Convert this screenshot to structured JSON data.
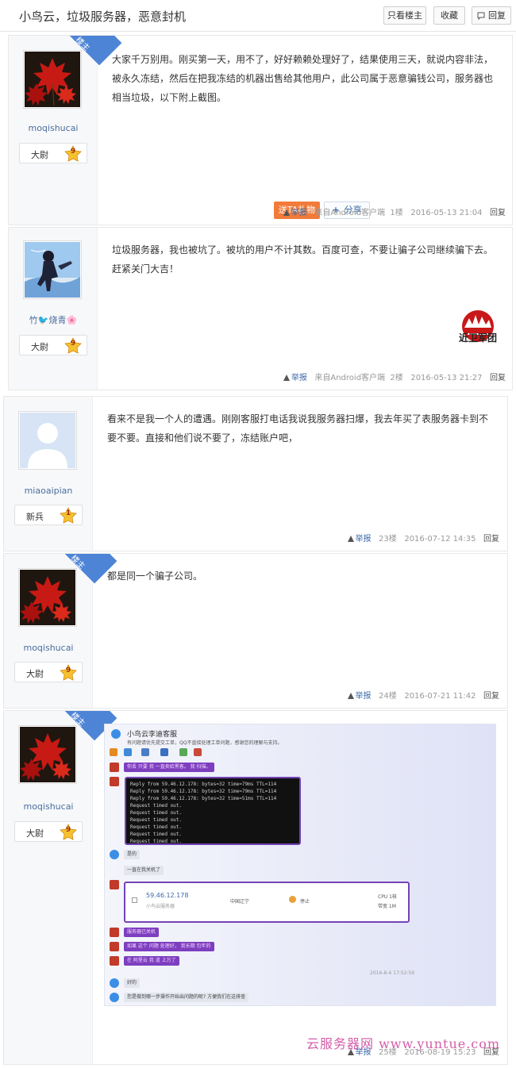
{
  "header": {
    "title": "小鸟云，垃圾服务器，恶意封机",
    "buttons": [
      "只看楼主",
      "收藏",
      "回复"
    ]
  },
  "colors": {
    "link": "#3a6aa8",
    "username": "#4a6e9e",
    "gift_button": "#f27b3a",
    "owner_badge": "#4d84d6",
    "chat_purple": "#7d3fbf",
    "watermark": "#d45ca9"
  },
  "icons": {
    "reply": "chat-bubble-icon",
    "report": "warning-triangle-icon",
    "share": "plus-icon",
    "rank": "star-badge-icon"
  },
  "common": {
    "owner_badge": "楼主",
    "report": "举报",
    "reply": "回复",
    "from_client": "来自Android客户端"
  },
  "posts": [
    {
      "owner": true,
      "username": "moqishucai",
      "rank": "大尉",
      "level": "9",
      "text": "大家千万别用。刚买第一天，用不了，好好赖赖处理好了，结果使用三天，就说内容非法，被永久冻结，然后在把我冻结的机器出售给其他用户，此公司属于恶意骗钱公司，服务器也相当垃圾，以下附上截图。",
      "gift": "送TA礼物",
      "share": "分享",
      "floor": "1楼",
      "time": "2016-05-13 21:04"
    },
    {
      "owner": false,
      "username": "竹🐦烧青🌸",
      "rank": "大尉",
      "level": "9",
      "text": "垃圾服务器，我也被坑了。被坑的用户不计其数。百度可查，不要让骗子公司继续骗下去。赶紧关门大吉！",
      "stamp": "近卫军团",
      "floor": "2楼",
      "time": "2016-05-13 21:27"
    },
    {
      "owner": false,
      "username": "miaoaipian",
      "rank": "新兵",
      "level": "1",
      "text": "看来不是我一个人的遭遇。刚刚客服打电话我说我服务器扫爆，我去年买了表服务器卡到不要不要。直接和他们说不要了，冻结账户吧，",
      "floor": "23楼",
      "time": "2016-07-12 14:35"
    },
    {
      "owner": true,
      "username": "moqishucai",
      "rank": "大尉",
      "level": "9",
      "text": "都是同一个骗子公司。",
      "floor": "24楼",
      "time": "2016-07-21 11:42"
    },
    {
      "owner": true,
      "username": "moqishucai",
      "rank": "大尉",
      "level": "9",
      "floor": "25楼",
      "time": "2016-08-19 15:23"
    }
  ],
  "screenshot": {
    "chat_title": "小鸟云李迪客服",
    "notice": "有问题请优先提交工单，QQ不直接处理工单问题，感谢您的理解与支持。",
    "msg1": "你丢 只要 我 一直卖给黑客。 我 扫描。",
    "terminal": [
      "Reply from 59.46.12.178: bytes=32 time=79ms TTL=114",
      "Reply from 59.46.12.178: bytes=32 time=79ms TTL=114",
      "Reply from 59.46.12.178: bytes=32 time=51ms TTL=114",
      "Request timed out.",
      "Request timed out.",
      "Request timed out.",
      "Request timed out.",
      "Request timed out.",
      "Request timed out."
    ],
    "reply1": "是的",
    "reply2": "一直在我关机了",
    "server_ip": "59.46.12.178",
    "server_name": "小鸟云服务器",
    "server_region": "中国辽宁",
    "server_status": "停止",
    "server_spec1": "CPU 1核",
    "server_spec2": "带宽 1M",
    "msg2": "服务器已关机",
    "msg3": "如果 这个 问题 处理好， 我长期 包年的",
    "msg4": "在 阿里云 我 道 上万了",
    "timestamp": "2016-8-4 17:52:59",
    "reply3": "好的",
    "reply4": "您是做到哪一步操作开始出问题的呢? 方便我们在这排查"
  },
  "watermark": "云服务器网 www.yuntue.com"
}
